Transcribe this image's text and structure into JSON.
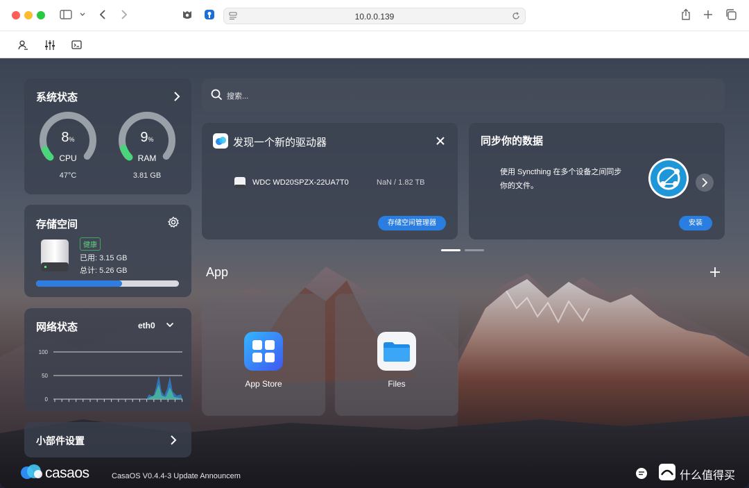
{
  "browser": {
    "address": "10.0.0.139"
  },
  "system_status": {
    "title": "系统状态",
    "cpu": {
      "value": "8",
      "unit": "%",
      "label": "CPU",
      "sub": "47°C",
      "percent": 8
    },
    "ram": {
      "value": "9",
      "unit": "%",
      "label": "RAM",
      "sub": "3.81 GB",
      "percent": 9
    }
  },
  "storage": {
    "title": "存储空间",
    "badge": "健康",
    "used": "已用: 3.15 GB",
    "total": "总计: 5.26 GB",
    "usage_fraction": 0.6
  },
  "network": {
    "title": "网络状态",
    "interface": "eth0",
    "y_ticks": [
      "100",
      "50",
      "0"
    ]
  },
  "widgets": {
    "label": "小部件设置"
  },
  "search": {
    "placeholder": "搜索..."
  },
  "drive_card": {
    "title": "发现一个新的驱动器",
    "drive_name": "WDC WD20SPZX-22UA7T0",
    "drive_size": "NaN / 1.82 TB",
    "button": "存储空间管理器"
  },
  "sync_card": {
    "title": "同步你的数据",
    "description_line1": "使用 Syncthing 在多个设备之间同步",
    "description_line2": "你的文件。",
    "button": "安装"
  },
  "apps": {
    "section_title": "App",
    "items": [
      {
        "label": "App Store",
        "icon": "app-store-icon"
      },
      {
        "label": "Files",
        "icon": "folder-icon"
      }
    ]
  },
  "footer": {
    "brand": "casaos",
    "announcement": "CasaOS V0.4.4-3 Update Announcem",
    "watermark": "什么值得买"
  },
  "colors": {
    "accent": "#2a7de1",
    "gauge_track": "#9aa0a8",
    "gauge_fill": "#49d67a",
    "healthy": "#5fd07f"
  }
}
